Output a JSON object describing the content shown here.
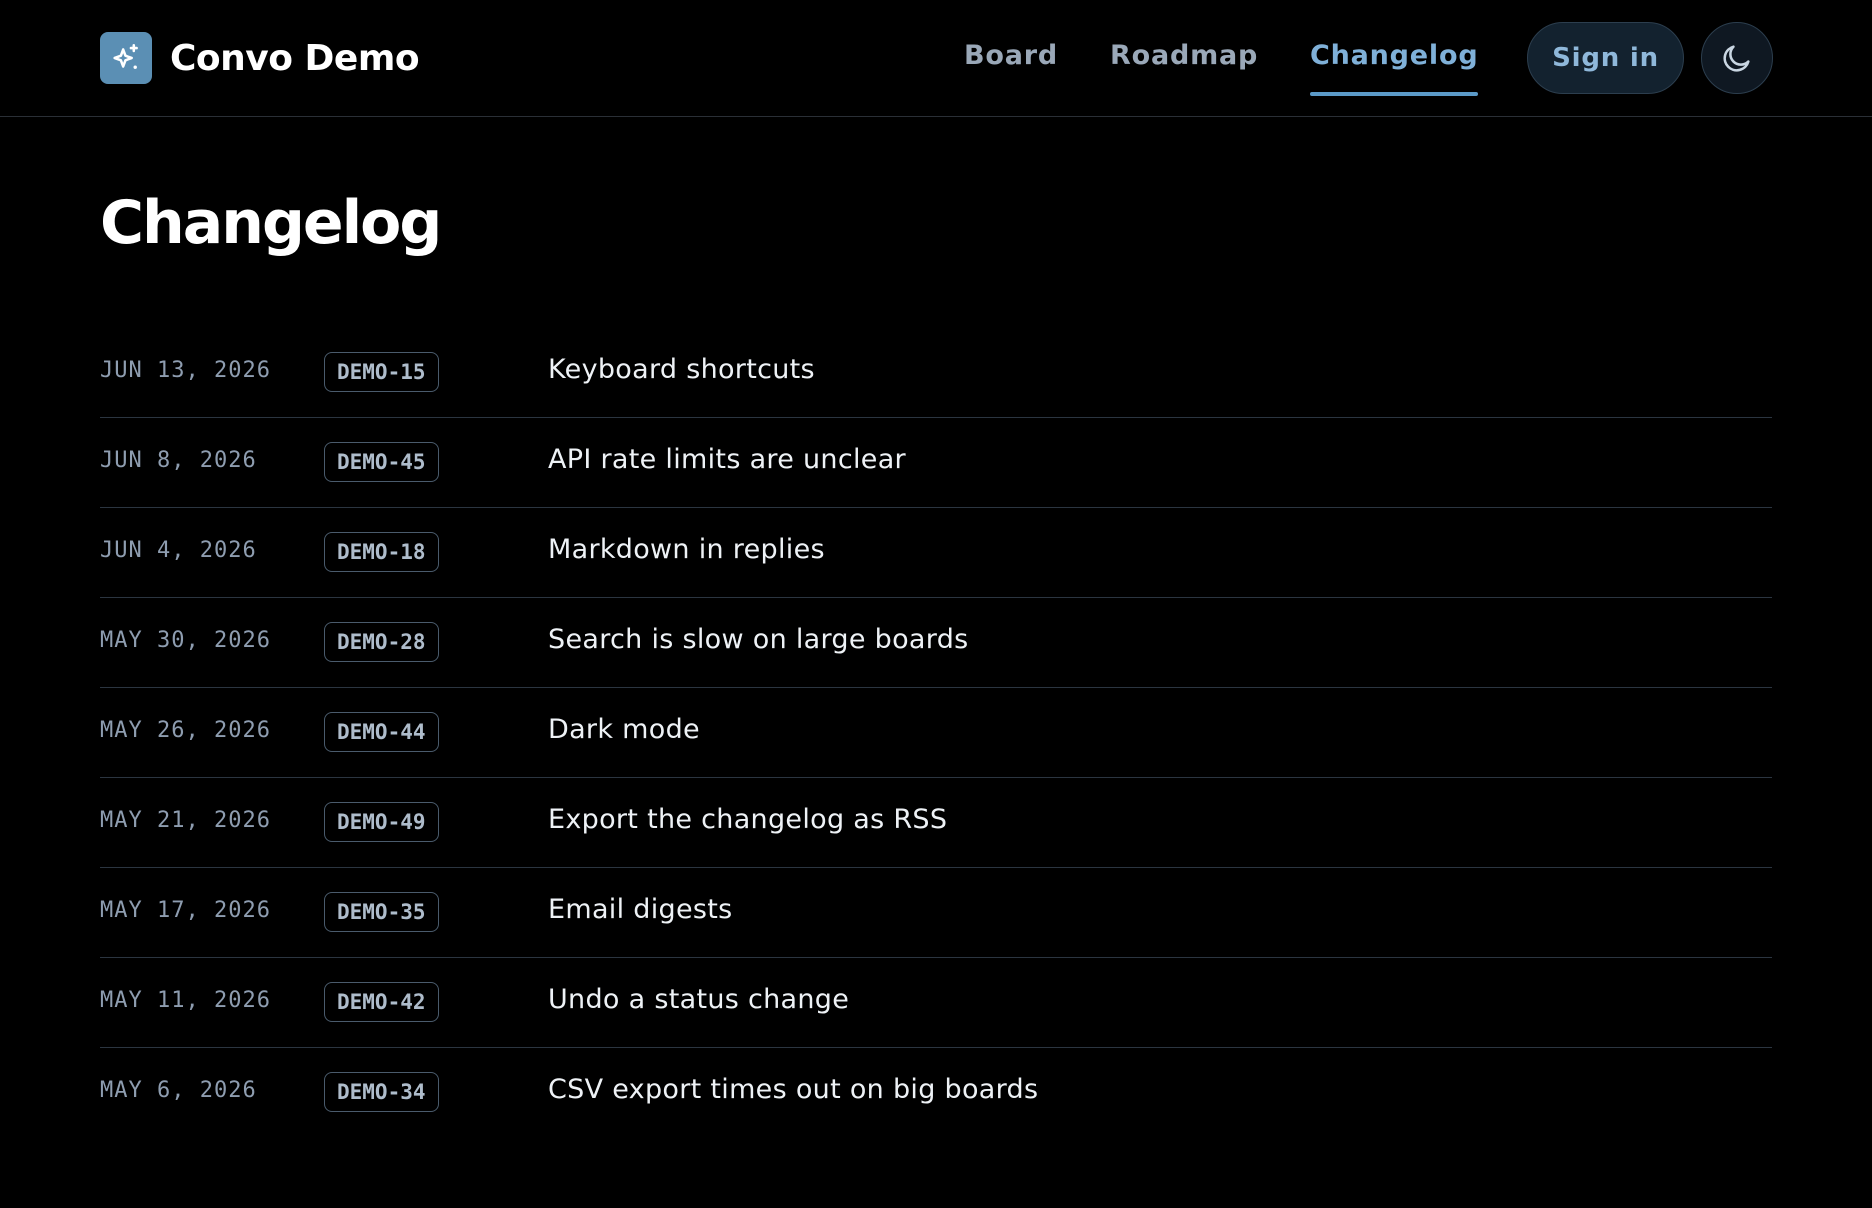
{
  "brand": {
    "name": "Convo Demo",
    "logo_icon": "sparkles-icon",
    "logo_color": "#5b8fb4"
  },
  "nav": {
    "items": [
      {
        "label": "Board",
        "active": false
      },
      {
        "label": "Roadmap",
        "active": false
      },
      {
        "label": "Changelog",
        "active": true
      }
    ],
    "sign_in_label": "Sign in",
    "theme_toggle_icon": "moon-icon"
  },
  "page": {
    "title": "Changelog"
  },
  "changelog": {
    "entries": [
      {
        "date": "JUN 13, 2026",
        "id": "DEMO-15",
        "title": "Keyboard shortcuts"
      },
      {
        "date": "JUN 8, 2026",
        "id": "DEMO-45",
        "title": "API rate limits are unclear"
      },
      {
        "date": "JUN 4, 2026",
        "id": "DEMO-18",
        "title": "Markdown in replies"
      },
      {
        "date": "MAY 30, 2026",
        "id": "DEMO-28",
        "title": "Search is slow on large boards"
      },
      {
        "date": "MAY 26, 2026",
        "id": "DEMO-44",
        "title": "Dark mode"
      },
      {
        "date": "MAY 21, 2026",
        "id": "DEMO-49",
        "title": "Export the changelog as RSS"
      },
      {
        "date": "MAY 17, 2026",
        "id": "DEMO-35",
        "title": "Email digests"
      },
      {
        "date": "MAY 11, 2026",
        "id": "DEMO-42",
        "title": "Undo a status change"
      },
      {
        "date": "MAY 6, 2026",
        "id": "DEMO-34",
        "title": "CSV export times out on big boards"
      }
    ]
  },
  "colors": {
    "background": "#000000",
    "accent": "#7fb0d8",
    "nav_text": "#9aa8b8",
    "divider": "#2b3540"
  }
}
